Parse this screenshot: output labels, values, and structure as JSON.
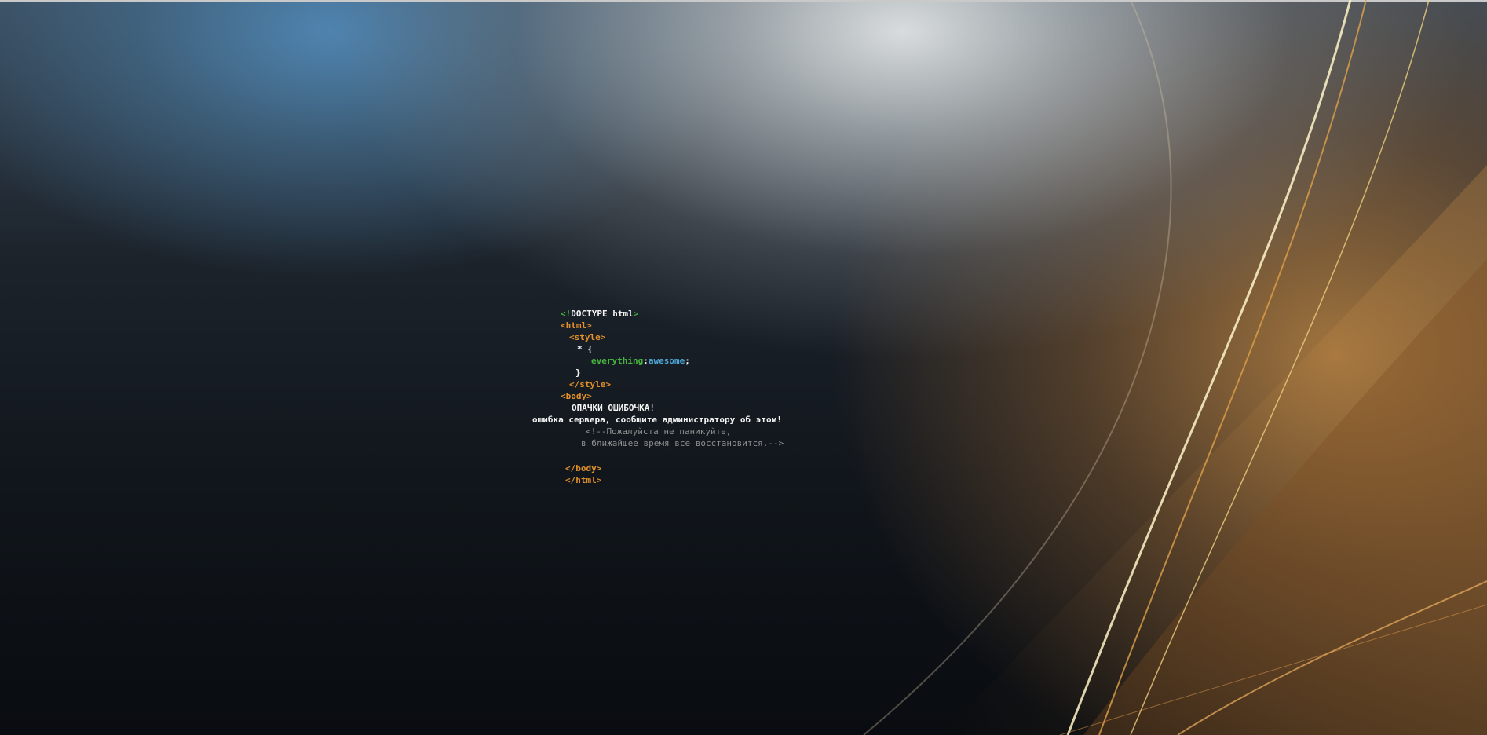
{
  "code": {
    "doctype_open": "<!",
    "doctype_text": "DOCTYPE html",
    "doctype_close": ">",
    "html_open": "<html>",
    "style_open": "<style>",
    "rule_selector": "* {",
    "property": "everything",
    "colon": ":",
    "value": "awesome",
    "semicolon": ";",
    "rule_close": "}",
    "style_close": "</style>",
    "body_open": "<body>",
    "heading": "ОПАЧКИ ОШИБОЧКА!",
    "message": "ошибка сервера, сообщите администратору об этом!",
    "comment_line1": "<!--Пожалуйста не паникуйте,",
    "comment_line2": "в ближайшее время все восстановится.-->",
    "body_close": "</body>",
    "html_close": "</html>"
  },
  "colors": {
    "tag": "#e1902b",
    "doctype_bracket": "#46b53e",
    "property": "#46b53e",
    "value": "#4ea7d8",
    "comment": "#8f8f8f",
    "text": "#f4f4f4"
  }
}
